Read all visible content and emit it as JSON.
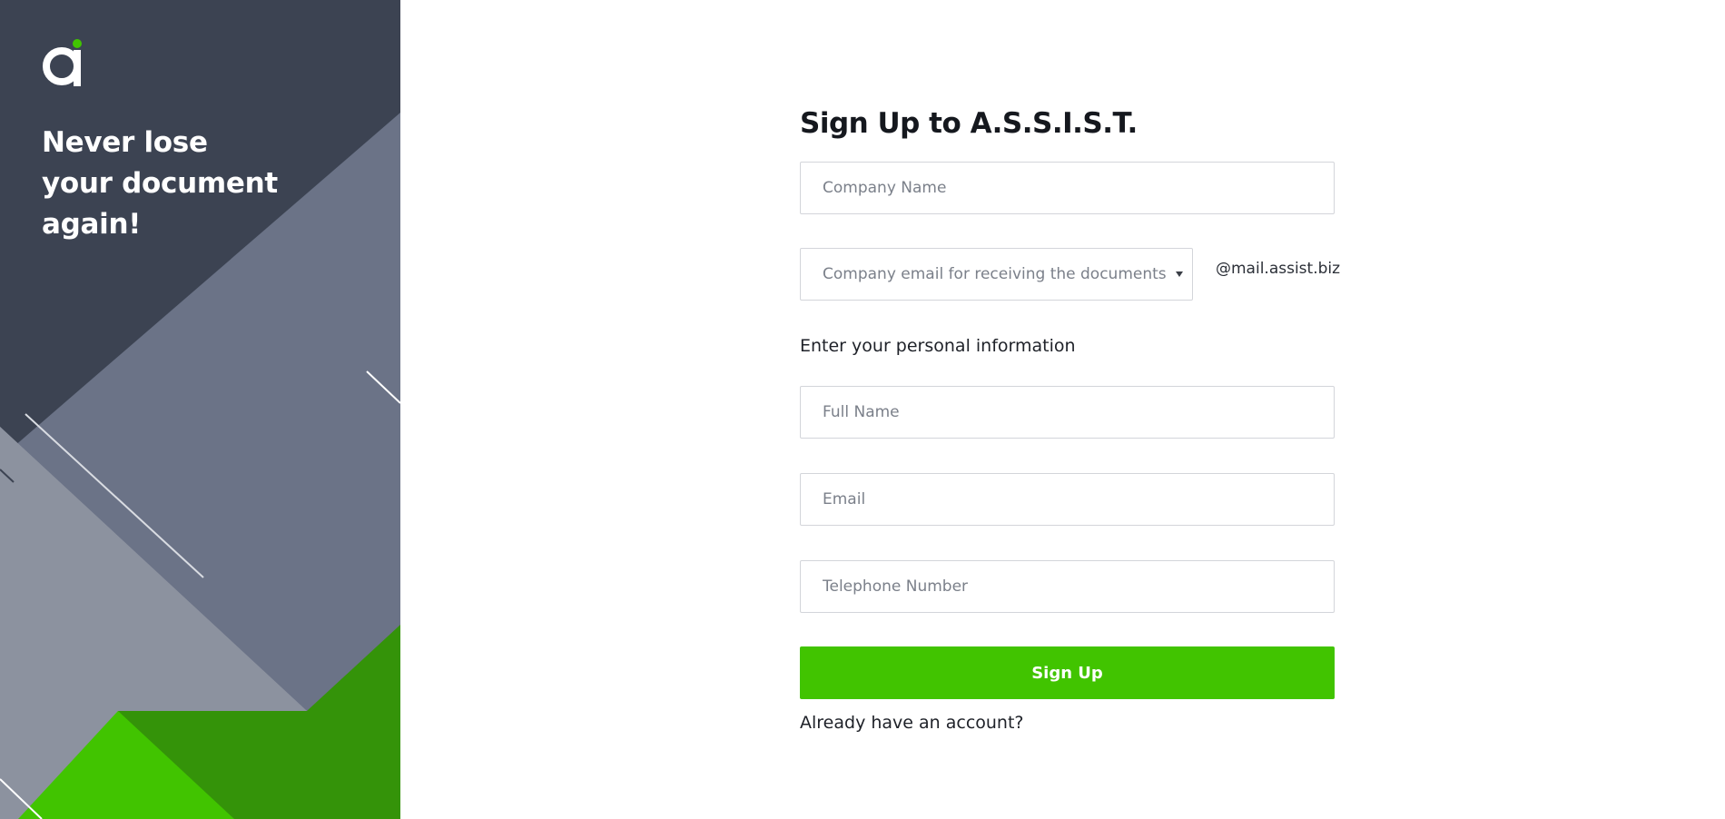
{
  "hero": {
    "tagline_lines": [
      "Never lose",
      "your document",
      "again!"
    ],
    "logo_icon": "assist-logo-icon",
    "colors": {
      "background": "#3c4352",
      "slate": "#6b7387",
      "light_gray": "#8c929f",
      "dark_green": "#349309",
      "bright_green": "#41c400"
    }
  },
  "form": {
    "title": "Sign Up to A.S.S.I.S.T.",
    "company_name": {
      "placeholder": "Company Name",
      "value": ""
    },
    "company_email_select": {
      "placeholder": "Company email for receiving the documents",
      "caret_icon": "caret-down-icon"
    },
    "domain_suffix": "@mail.assist.biz",
    "personal_section_label": "Enter your personal information",
    "full_name": {
      "placeholder": "Full Name",
      "value": ""
    },
    "email": {
      "placeholder": "Email",
      "value": ""
    },
    "telephone": {
      "placeholder": "Telephone Number",
      "value": ""
    },
    "submit_label": "Sign Up",
    "login_link": "Already have an account?",
    "accent_color": "#41c400"
  }
}
